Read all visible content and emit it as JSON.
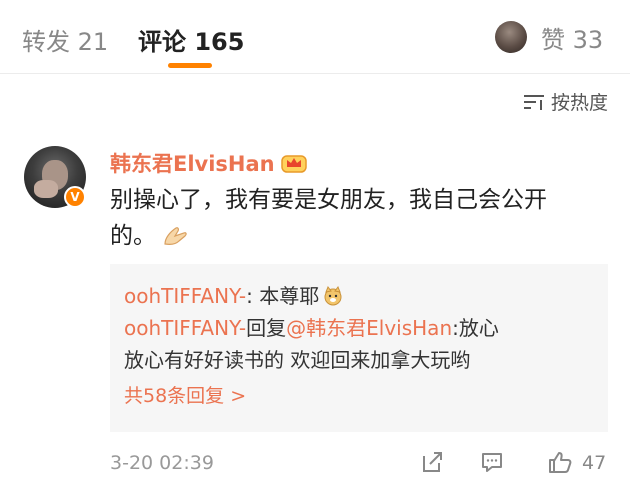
{
  "tabs": {
    "repost": "转发 21",
    "comment": "评论 165",
    "likes": "赞 33"
  },
  "sort": {
    "label": "按热度",
    "icon": "sort-lines-icon"
  },
  "comment": {
    "username": "韩东君ElvisHan",
    "verified_badge": "V",
    "line1": "别操心了，我有要是女朋友，我自己会公开",
    "line2": "的。",
    "emoji": "clasped-hands-emoji",
    "timestamp": "3-20 02:39",
    "like_count": "47"
  },
  "replies": [
    {
      "user": "oohTIFFANY-",
      "text": ": 本尊耶",
      "emoji": "doge-emoji"
    },
    {
      "user": "oohTIFFANY-",
      "text_prefix": "回复",
      "mention": "@韩东君ElvisHan",
      "text": ":放心",
      "text_line2": "放心有好好读书的 欢迎回来加拿大玩哟"
    }
  ],
  "more_replies": "共58条回复 >",
  "colors": {
    "accent": "#ff8200",
    "username": "#eb7350",
    "reply_bg": "#f6f6f6"
  }
}
